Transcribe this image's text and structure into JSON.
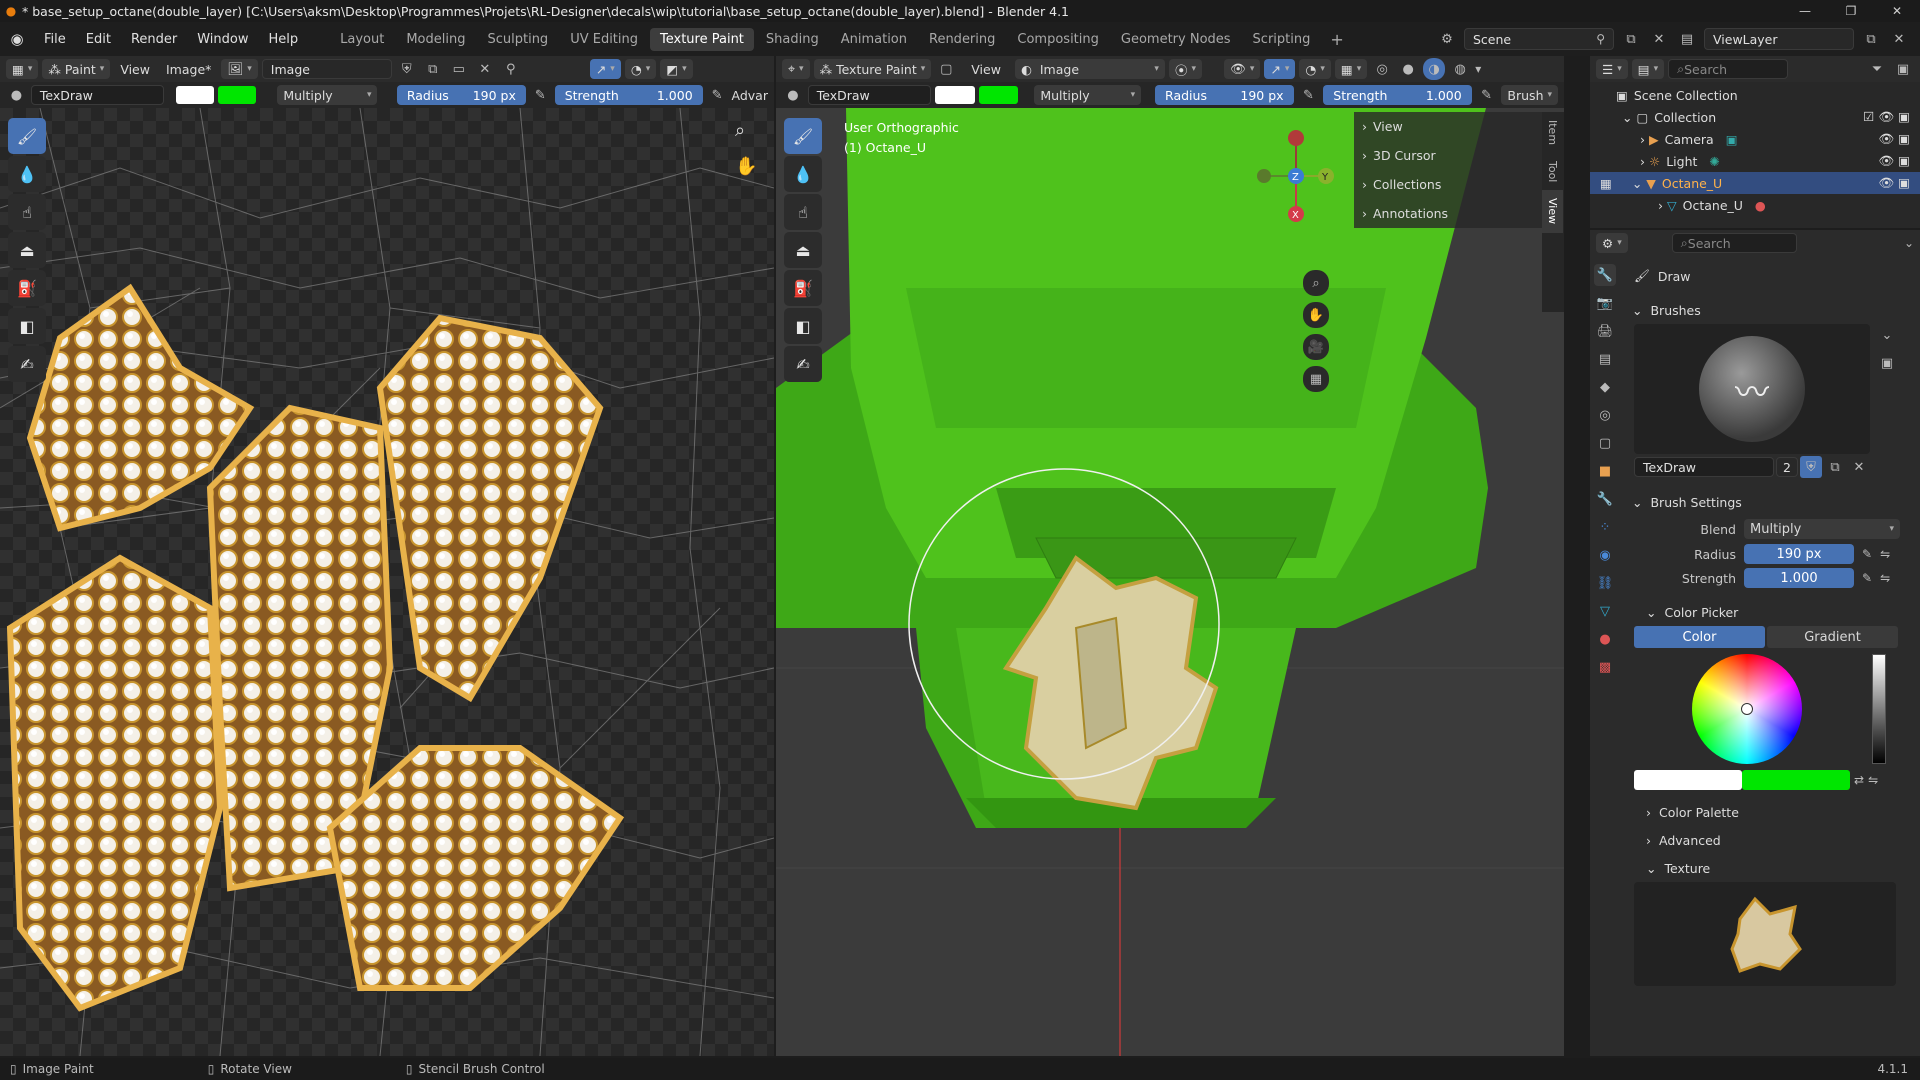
{
  "window": {
    "title": "* base_setup_octane(double_layer) [C:\\Users\\aksm\\Desktop\\Programmes\\Projets\\RL-Designer\\decals\\wip\\tutorial\\base_setup_octane(double_layer).blend] - Blender 4.1",
    "minimize": "—",
    "maximize": "❐",
    "close": "✕"
  },
  "menu": [
    "File",
    "Edit",
    "Render",
    "Window",
    "Help"
  ],
  "workspaces": [
    "Layout",
    "Modeling",
    "Sculpting",
    "UV Editing",
    "Texture Paint",
    "Shading",
    "Animation",
    "Rendering",
    "Compositing",
    "Geometry Nodes",
    "Scripting"
  ],
  "active_workspace": "Texture Paint",
  "scene": {
    "label": "Scene",
    "view_layer": "ViewLayer"
  },
  "image_editor": {
    "mode": "Paint",
    "menus": [
      "View",
      "Image*"
    ],
    "image_name": "Image",
    "brush_name": "TexDraw",
    "blend": "Multiply",
    "radius_label": "Radius",
    "radius_value": "190 px",
    "strength_label": "Strength",
    "strength_value": "1.000",
    "advanced_label": "Advar",
    "colors": {
      "primary": "#ffffff",
      "secondary": "#00e600"
    }
  },
  "viewport": {
    "mode": "Texture Paint",
    "view_menu": "View",
    "image_name": "Image",
    "brush_name": "TexDraw",
    "blend": "Multiply",
    "radius_label": "Radius",
    "radius_value": "190 px",
    "strength_label": "Strength",
    "strength_value": "1.000",
    "brush_menu": "Brush",
    "overlay_title": "User Orthographic",
    "overlay_object": "(1) Octane_U",
    "gizmo": {
      "z": "Z",
      "y": "Y",
      "x": "X"
    },
    "n_panel": [
      "View",
      "3D Cursor",
      "Collections",
      "Annotations"
    ],
    "side_tabs": [
      "Item",
      "Tool",
      "View"
    ]
  },
  "outliner": {
    "search_placeholder": "Search",
    "root": "Scene Collection",
    "collection": "Collection",
    "items": [
      "Camera",
      "Light",
      "Octane_U"
    ],
    "child": "Octane_U"
  },
  "properties": {
    "search_placeholder": "Search",
    "tool": "Draw",
    "brushes_header": "Brushes",
    "brush_name": "TexDraw",
    "brush_users": "2",
    "brush_settings_header": "Brush Settings",
    "blend_label": "Blend",
    "blend_value": "Multiply",
    "radius_label": "Radius",
    "radius_value": "190 px",
    "strength_label": "Strength",
    "strength_value": "1.000",
    "color_picker_header": "Color Picker",
    "color_tab": "Color",
    "gradient_tab": "Gradient",
    "color_palette": "Color Palette",
    "advanced": "Advanced",
    "texture": "Texture"
  },
  "status": {
    "left": "Image Paint",
    "middle": "Rotate View",
    "right": "Stencil Brush Control",
    "version": "4.1.1"
  }
}
